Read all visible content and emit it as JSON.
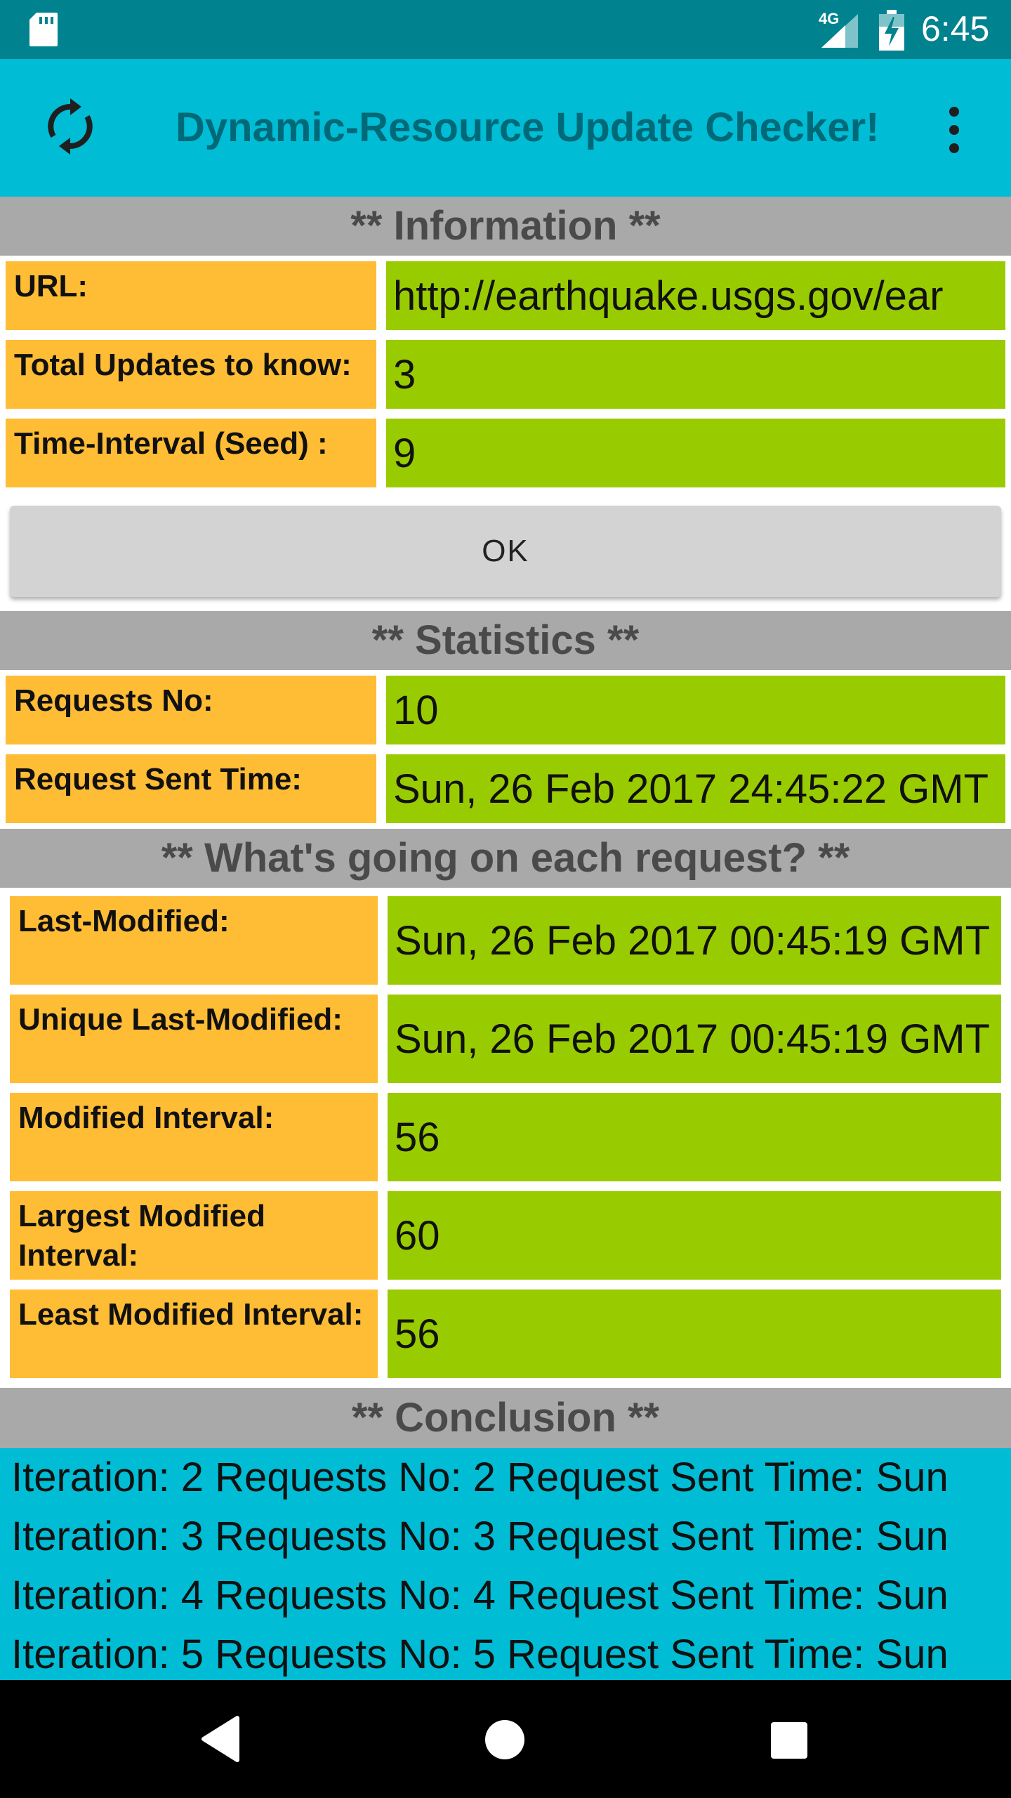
{
  "status_bar": {
    "time": "6:45",
    "network": "4G",
    "icons": [
      "sd-card-icon",
      "signal-icon",
      "battery-charging-icon"
    ],
    "colors": {
      "background": "#00838f"
    }
  },
  "app_bar": {
    "title": "Dynamic-Resource Update Checker!",
    "icons": [
      "refresh-icon",
      "overflow-menu-icon"
    ],
    "colors": {
      "background": "#00bcd4",
      "title": "#006978"
    }
  },
  "information": {
    "header": "** Information **",
    "rows": [
      {
        "label": "URL:",
        "value": "http://earthquake.usgs.gov/ear"
      },
      {
        "label": "Total Updates to know:",
        "value": "3"
      },
      {
        "label": "Time-Interval (Seed) :",
        "value": "9"
      }
    ],
    "ok_label": "OK"
  },
  "statistics": {
    "header": "** Statistics **",
    "rows": [
      {
        "label": "Requests No:",
        "value": "10"
      },
      {
        "label": "Request Sent Time:",
        "value": "Sun, 26 Feb 2017 24:45:22 GMT"
      }
    ]
  },
  "each_request": {
    "header": "** What's going on each request? **",
    "rows": [
      {
        "label": "Last-Modified:",
        "value": "Sun, 26 Feb 2017 00:45:19 GMT"
      },
      {
        "label": "Unique Last-Modified:",
        "value": "Sun, 26 Feb 2017 00:45:19 GMT"
      },
      {
        "label": "Modified Interval:",
        "value": "56"
      },
      {
        "label": "Largest Modified Interval:",
        "value": "60"
      },
      {
        "label": "Least Modified Interval:",
        "value": "56"
      }
    ]
  },
  "conclusion": {
    "header": "** Conclusion **",
    "rows": [
      "Iteration: 2  Requests No:  2 Request Sent Time: Sun",
      "Iteration: 3  Requests No:  3 Request Sent Time: Sun",
      "Iteration: 4  Requests No:  4 Request Sent Time: Sun",
      "Iteration: 5  Requests No:  5 Request Sent Time: Sun"
    ]
  },
  "nav_bar": {
    "icons": [
      "back-icon",
      "home-icon",
      "recents-icon"
    ]
  },
  "colors": {
    "label_bg": "#ffbc35",
    "value_bg": "#99cc00",
    "section_bg": "#a9a9a9",
    "conclusion_bg": "#00bcd4"
  }
}
